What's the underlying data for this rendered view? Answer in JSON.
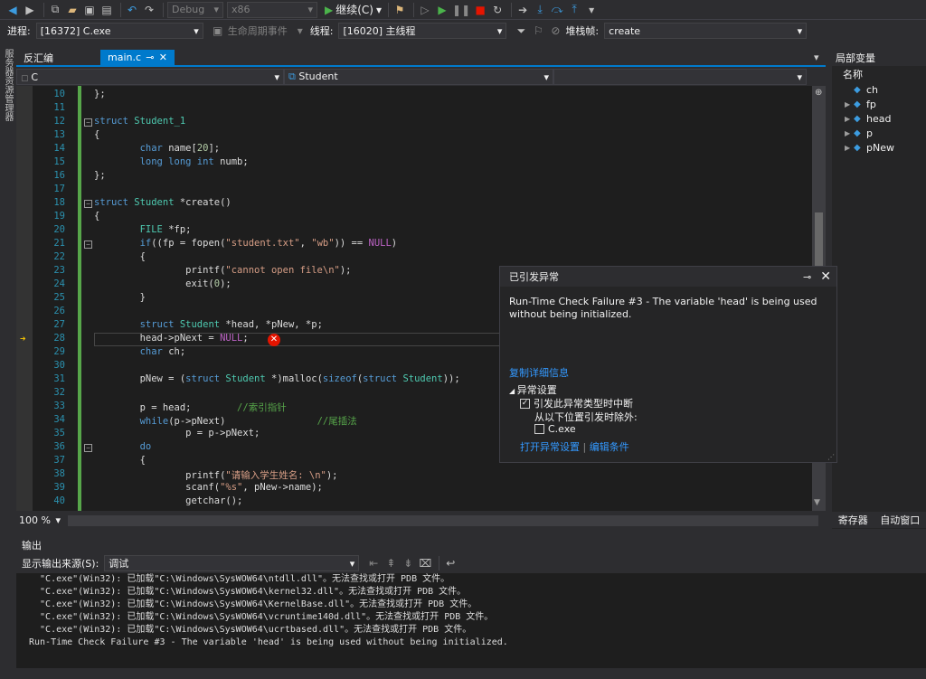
{
  "toolbar": {
    "config": "Debug",
    "platform": "x86",
    "continue_label": "继续(C)"
  },
  "debugbar": {
    "process_label": "进程:",
    "process_value": "[16372] C.exe",
    "lifecycle_label": "生命周期事件",
    "thread_label": "线程:",
    "thread_value": "[16020] 主线程",
    "stack_label": "堆栈帧:",
    "stack_value": "create"
  },
  "left_tabs": "服务器资源管理器",
  "tabs": [
    {
      "label": "反汇编"
    },
    {
      "label": "main.c"
    }
  ],
  "nav": {
    "scope": "C",
    "member": "Student"
  },
  "code_lines": [
    {
      "n": "10",
      "html": "};"
    },
    {
      "n": "11",
      "html": ""
    },
    {
      "n": "12",
      "html": "<span class='kw'>struct</span> <span class='ty'>Student_1</span>"
    },
    {
      "n": "13",
      "html": "{"
    },
    {
      "n": "14",
      "html": "        <span class='kw'>char</span> name[<span class='nm'>20</span>];"
    },
    {
      "n": "15",
      "html": "        <span class='kw'>long long int</span> numb;"
    },
    {
      "n": "16",
      "html": "};"
    },
    {
      "n": "17",
      "html": ""
    },
    {
      "n": "18",
      "html": "<span class='kw'>struct</span> <span class='ty'>Student</span> *create()"
    },
    {
      "n": "19",
      "html": "{"
    },
    {
      "n": "20",
      "html": "        <span class='ty'>FILE</span> *fp;"
    },
    {
      "n": "21",
      "html": "        <span class='kw'>if</span>((fp = fopen(<span class='st'>\"student.txt\"</span>, <span class='st'>\"wb\"</span>)) == <span class='mac'>NULL</span>)"
    },
    {
      "n": "22",
      "html": "        {"
    },
    {
      "n": "23",
      "html": "                printf(<span class='st'>\"cannot open file\\n\"</span>);"
    },
    {
      "n": "24",
      "html": "                exit(<span class='nm'>0</span>);"
    },
    {
      "n": "25",
      "html": "        }"
    },
    {
      "n": "26",
      "html": ""
    },
    {
      "n": "27",
      "html": "        <span class='kw'>struct</span> <span class='ty'>Student</span> *head, *pNew, *p;"
    },
    {
      "n": "28",
      "html": "        head->pNext = <span class='mac'>NULL</span>;"
    },
    {
      "n": "29",
      "html": "        <span class='kw'>char</span> ch;"
    },
    {
      "n": "30",
      "html": ""
    },
    {
      "n": "31",
      "html": "        pNew = (<span class='kw'>struct</span> <span class='ty'>Student</span> *)malloc(<span class='kw'>sizeof</span>(<span class='kw'>struct</span> <span class='ty'>Student</span>));"
    },
    {
      "n": "32",
      "html": ""
    },
    {
      "n": "33",
      "html": "        p = head;        <span class='cm'>//索引指针</span>"
    },
    {
      "n": "34",
      "html": "        <span class='kw'>while</span>(p->pNext)                <span class='cm'>//尾插法</span>"
    },
    {
      "n": "35",
      "html": "                p = p->pNext;"
    },
    {
      "n": "36",
      "html": "        <span class='kw'>do</span>"
    },
    {
      "n": "37",
      "html": "        {"
    },
    {
      "n": "38",
      "html": "                printf(<span class='st'>\"请输入学生姓名: \\n\"</span>);"
    },
    {
      "n": "39",
      "html": "                scanf(<span class='st'>\"%s\"</span>, pNew->name);"
    },
    {
      "n": "40",
      "html": "                getchar();"
    }
  ],
  "zoom": "100 %",
  "locals": {
    "title": "局部变量",
    "header": "名称",
    "items": [
      {
        "name": "ch",
        "expand": false
      },
      {
        "name": "fp",
        "expand": true
      },
      {
        "name": "head",
        "expand": true
      },
      {
        "name": "p",
        "expand": true
      },
      {
        "name": "pNew",
        "expand": true
      }
    ],
    "tab1": "寄存器",
    "tab2": "自动窗口"
  },
  "popup": {
    "title": "已引发异常",
    "message": "Run-Time Check Failure #3 - The variable 'head' is being used without being initialized.",
    "copy_link": "复制详细信息",
    "settings_title": "异常设置",
    "break_label": "引发此异常类型时中断",
    "except_label": "从以下位置引发时除外:",
    "exe_label": "C.exe",
    "open_settings": "打开异常设置",
    "edit_conditions": "编辑条件"
  },
  "output": {
    "title": "输出",
    "source_label": "显示输出来源(S):",
    "source_value": "调试",
    "lines": [
      "  \"C.exe\"(Win32): 已加载\"C:\\Windows\\SysWOW64\\ntdll.dll\"。无法查找或打开 PDB 文件。",
      "  \"C.exe\"(Win32): 已加载\"C:\\Windows\\SysWOW64\\kernel32.dll\"。无法查找或打开 PDB 文件。",
      "  \"C.exe\"(Win32): 已加载\"C:\\Windows\\SysWOW64\\KernelBase.dll\"。无法查找或打开 PDB 文件。",
      "  \"C.exe\"(Win32): 已加载\"C:\\Windows\\SysWOW64\\vcruntime140d.dll\"。无法查找或打开 PDB 文件。",
      "  \"C.exe\"(Win32): 已加载\"C:\\Windows\\SysWOW64\\ucrtbased.dll\"。无法查找或打开 PDB 文件。",
      "Run-Time Check Failure #3 - The variable 'head' is being used without being initialized."
    ]
  }
}
